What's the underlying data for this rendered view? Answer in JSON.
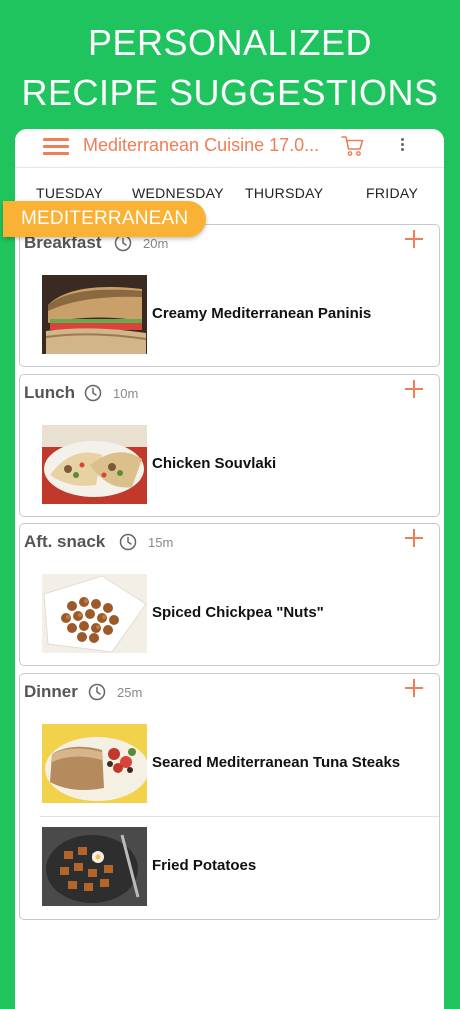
{
  "headline": {
    "line1": "PERSONALIZED",
    "line2": "RECIPE SUGGESTIONS"
  },
  "appbar": {
    "title": "Mediterranean Cuisine 17.0...",
    "menu_icon": "hamburger-menu-icon",
    "cart_icon": "cart-icon",
    "more_icon": "more-vert-icon"
  },
  "days": [
    "TUESDAY",
    "WEDNESDAY",
    "THURSDAY",
    "FRIDAY"
  ],
  "badge": "MEDITERRANEAN",
  "colors": {
    "background": "#20c45e",
    "accent": "#ef7d55",
    "badge": "#f9b233"
  },
  "meals": [
    {
      "name": "Breakfast",
      "time": "20m",
      "recipes": [
        "Creamy Mediterranean Paninis"
      ]
    },
    {
      "name": "Lunch",
      "time": "10m",
      "recipes": [
        "Chicken Souvlaki"
      ]
    },
    {
      "name": "Aft. snack",
      "time": "15m",
      "recipes": [
        "Spiced Chickpea \"Nuts\""
      ]
    },
    {
      "name": "Dinner",
      "time": "25m",
      "recipes": [
        "Seared Mediterranean Tuna Steaks",
        "Fried Potatoes"
      ]
    }
  ]
}
